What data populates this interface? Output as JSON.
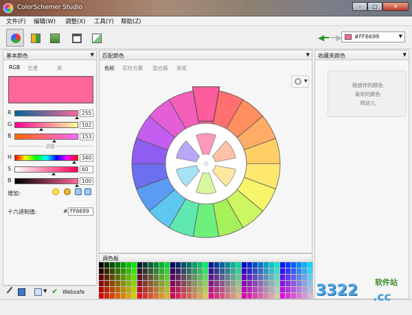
{
  "window": {
    "title": "ColorSchemer Studio",
    "min": "–",
    "max": "□",
    "close": "✕"
  },
  "menu": [
    "文件(F)",
    "编辑(W)",
    "调整(X)",
    "工具(Y)",
    "帮助(Z)"
  ],
  "toolbar": {
    "current_hex": "#FF6699",
    "current_color": "#ff6699"
  },
  "basic_panel": {
    "title": "基本颜色",
    "tabs": [
      "RGB",
      "光谱",
      "库"
    ],
    "swatch_color": "#ff6699",
    "sliders": [
      {
        "label": "R",
        "value": "255",
        "frac": 1.0
      },
      {
        "label": "G",
        "value": "102",
        "frac": 0.4
      },
      {
        "label": "B",
        "value": "153",
        "frac": 0.6
      },
      {
        "label": "H",
        "value": "340",
        "frac": 0.944
      },
      {
        "label": "S",
        "value": "60",
        "frac": 0.6
      },
      {
        "label": "B",
        "value": "100",
        "frac": 1.0
      }
    ],
    "separator": "调整",
    "add_label": "增加:",
    "hex_label": "十六进制值:",
    "hex_prefix": "#",
    "hex_value": "FF6699",
    "bottom_label": "Websafe"
  },
  "scheme_panel": {
    "title": "匹配颜色",
    "tabs": [
      "色轮",
      "实时方案",
      "混合器",
      "渐变"
    ],
    "wheel": {
      "outer_colors": [
        "#ff5c9e",
        "#ff6f6f",
        "#ff8f5f",
        "#ffad66",
        "#ffcf66",
        "#ffe770",
        "#f7f66a",
        "#ccf760",
        "#a6f05a",
        "#6ef07c",
        "#5fe8b0",
        "#5ec7f0",
        "#5a9cf2",
        "#6b6ff0",
        "#8f5ef0",
        "#c45ef0",
        "#e45ed8",
        "#f25eb8"
      ],
      "inner_colors": [
        "#ff99bb",
        "#ffc2a8",
        "#ffe9a0",
        "#d6f7a0",
        "#a6e1f7",
        "#b8a8f7"
      ]
    }
  },
  "fav_panel": {
    "title": "收藏夹颜色",
    "lines": [
      "拖放你的颜色",
      "喜欢的颜色",
      "到这儿"
    ]
  },
  "palette": {
    "title": "调色板"
  },
  "watermark": {
    "number": "3322",
    "site": "软件站",
    "cc": ".cc"
  }
}
